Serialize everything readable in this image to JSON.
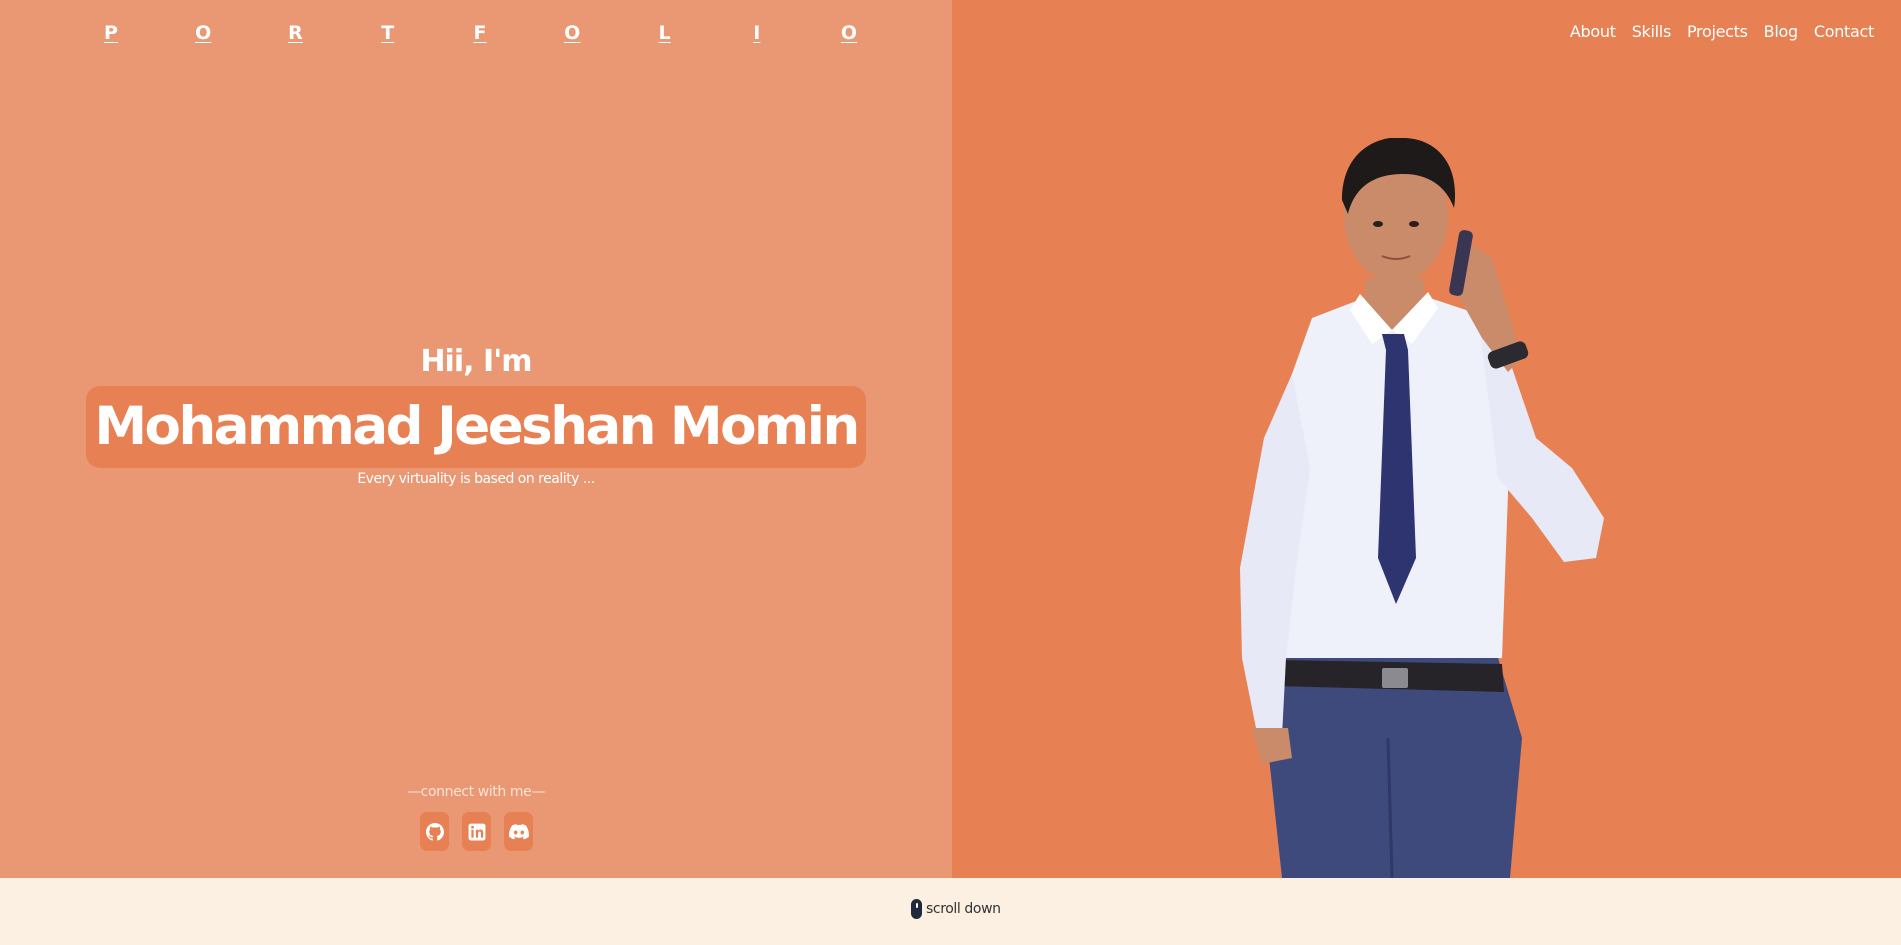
{
  "logo": {
    "letters": [
      "P",
      "O",
      "R",
      "T",
      "F",
      "O",
      "L",
      "I",
      "O"
    ]
  },
  "nav": {
    "items": [
      "About",
      "Skills",
      "Projects",
      "Blog",
      "Contact"
    ]
  },
  "hero": {
    "greeting": "Hii, I'm",
    "name": "Mohammad Jeeshan Momin",
    "tagline": "Every virtuality is based on reality ..."
  },
  "connect": {
    "label": "—connect with me—",
    "icons": [
      "github-icon",
      "linkedin-icon",
      "discord-icon"
    ]
  },
  "scroll": {
    "label": "scroll down",
    "icon": "mouse-icon"
  },
  "colors": {
    "left_panel": "#EA9873",
    "right_panel": "#E78153",
    "footer": "#FBF0E1",
    "accent": "#E78153"
  }
}
